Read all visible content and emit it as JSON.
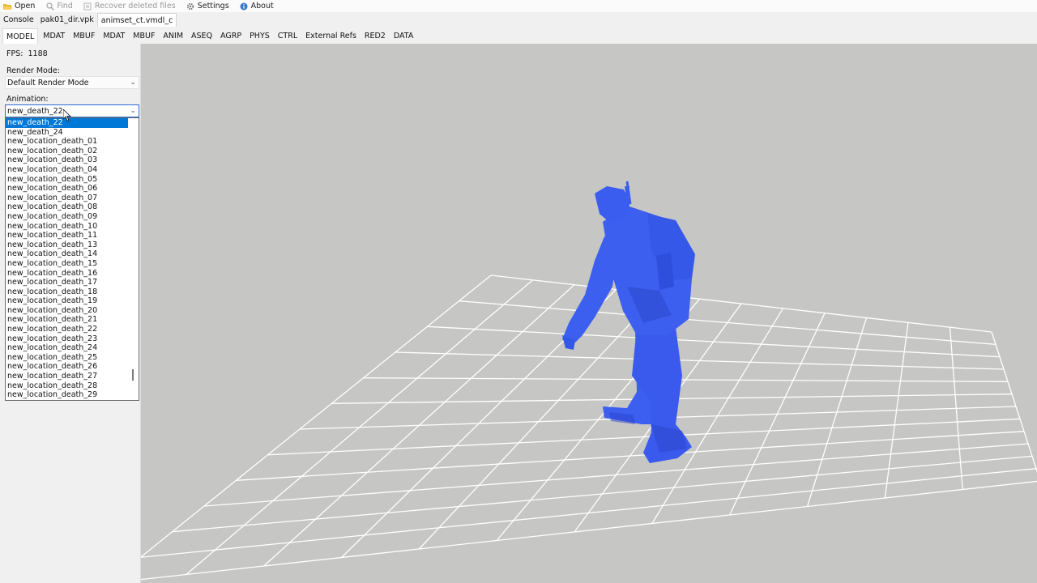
{
  "menubar": {
    "items": [
      {
        "label": "Open",
        "icon": "folder-open-icon",
        "enabled": true
      },
      {
        "label": "Find",
        "icon": "search-icon",
        "enabled": false
      },
      {
        "label": "Recover deleted files",
        "icon": "recover-icon",
        "enabled": false
      },
      {
        "label": "Settings",
        "icon": "gear-icon",
        "enabled": true
      },
      {
        "label": "About",
        "icon": "info-icon",
        "enabled": true
      }
    ]
  },
  "file_tabs": [
    "Console",
    "pak01_dir.vpk",
    "animset_ct.vmdl_c"
  ],
  "file_tabs_active": 2,
  "resource_tabs": [
    "MODEL",
    "MDAT",
    "MBUF",
    "MDAT",
    "MBUF",
    "ANIM",
    "ASEQ",
    "AGRP",
    "PHYS",
    "CTRL",
    "External Refs",
    "RED2",
    "DATA"
  ],
  "resource_tabs_active": 0,
  "side": {
    "fps_label": "FPS:",
    "fps_value": "1188",
    "render_mode_label": "Render Mode:",
    "render_mode_value": "Default Render Mode",
    "animation_label": "Animation:",
    "animation_value": "new_death_22"
  },
  "animation_options": [
    "new_death_22",
    "new_death_24",
    "new_location_death_01",
    "new_location_death_02",
    "new_location_death_03",
    "new_location_death_04",
    "new_location_death_05",
    "new_location_death_06",
    "new_location_death_07",
    "new_location_death_08",
    "new_location_death_09",
    "new_location_death_10",
    "new_location_death_11",
    "new_location_death_13",
    "new_location_death_14",
    "new_location_death_15",
    "new_location_death_16",
    "new_location_death_17",
    "new_location_death_18",
    "new_location_death_19",
    "new_location_death_20",
    "new_location_death_21",
    "new_location_death_22",
    "new_location_death_23",
    "new_location_death_24",
    "new_location_death_25",
    "new_location_death_26",
    "new_location_death_27",
    "new_location_death_28",
    "new_location_death_29"
  ],
  "animation_selected_index": 0,
  "colors": {
    "model_fill": "#3d5ff0",
    "model_shade": "#2a44c8",
    "grid_line": "#ffffff",
    "viewport_bg": "#c6c6c4",
    "selection": "#0078d7"
  }
}
